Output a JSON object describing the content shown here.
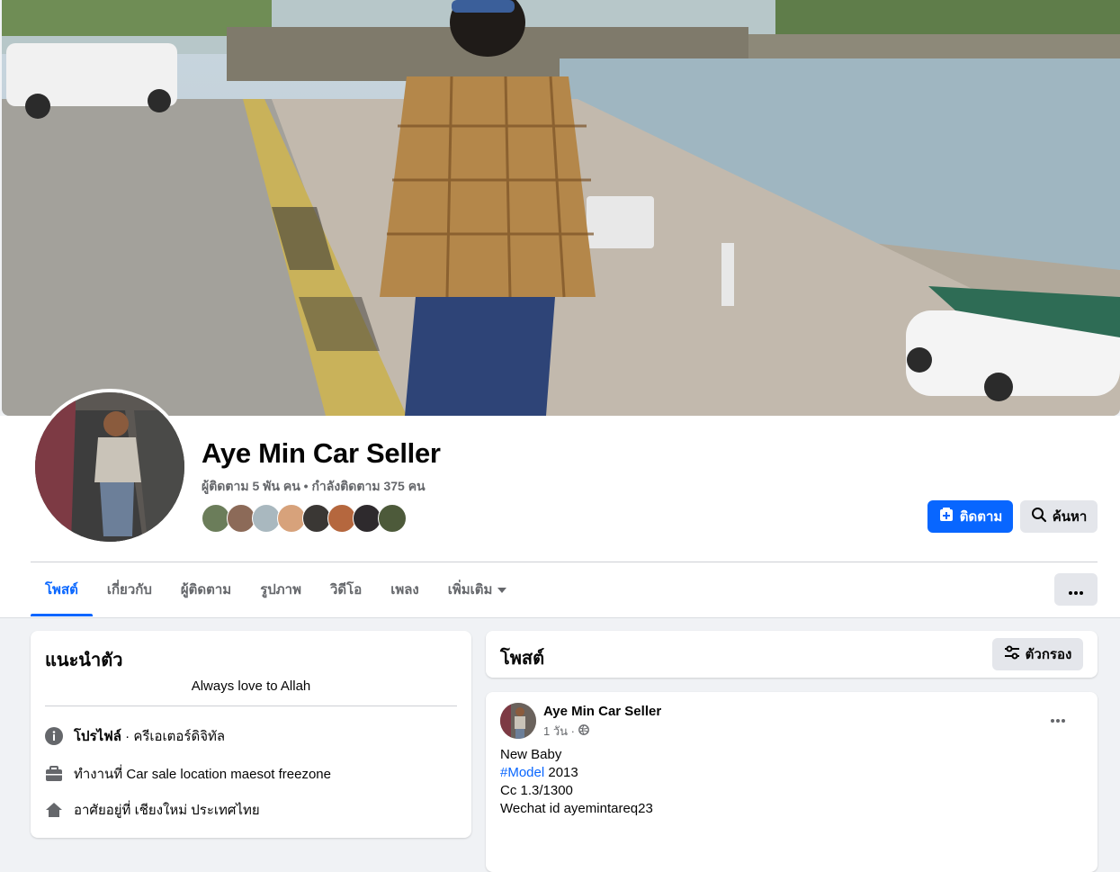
{
  "page": {
    "name": "Aye Min Car Seller",
    "stats": "ผู้ติดตาม 5 พัน คน • กำลังติดตาม 375 คน"
  },
  "actions": {
    "follow_label": "ติดตาม",
    "search_label": "ค้นหา"
  },
  "tabs": [
    {
      "label": "โพสต์",
      "active": true
    },
    {
      "label": "เกี่ยวกับ"
    },
    {
      "label": "ผู้ติดตาม"
    },
    {
      "label": "รูปภาพ"
    },
    {
      "label": "วิดีโอ"
    },
    {
      "label": "เพลง"
    },
    {
      "label": "เพิ่มเติม"
    }
  ],
  "intro": {
    "title": "แนะนำตัว",
    "bio": "Always love to Allah",
    "rows": [
      {
        "icon": "info-icon",
        "bold": "โปรไฟล์",
        "text": " · ครีเอเตอร์ดิจิทัล"
      },
      {
        "icon": "briefcase-icon",
        "text": "ทำงานที่ Car sale location maesot freezone"
      },
      {
        "icon": "home-icon",
        "text": "อาศัยอยู่ที่ เชียงใหม่ ประเทศไทย"
      }
    ]
  },
  "posts": {
    "title": "โพสต์",
    "filter_label": "ตัวกรอง"
  },
  "post": {
    "author": "Aye Min Car Seller",
    "time": "1 วัน ·",
    "lines": [
      "New Baby",
      "2013",
      "Cc 1.3/1300",
      "Wechat id ayemintareq23"
    ],
    "hashtag": "#Model"
  },
  "colors": {
    "brand": "#0866ff",
    "secondary_btn": "#e4e6eb",
    "text_secondary": "#65676b",
    "page_bg": "#f0f2f5"
  }
}
